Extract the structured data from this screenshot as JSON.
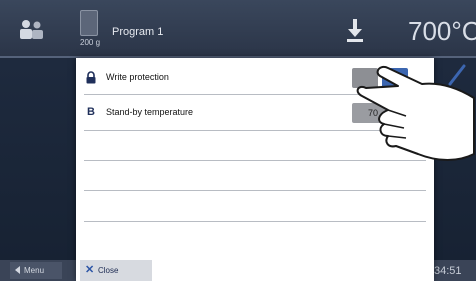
{
  "header": {
    "program_weight": "200 g",
    "program_title": "Program 1",
    "temperature": "700°C"
  },
  "dialog": {
    "rows": [
      {
        "icon": "lock-icon",
        "label": "Write protection",
        "control_a_label": "",
        "control_b_label": ""
      },
      {
        "icon": "B",
        "label": "Stand-by temperature",
        "value": "70"
      }
    ],
    "close_label": "Close"
  },
  "footer": {
    "menu_label": "Menu",
    "time": "34:51"
  },
  "colors": {
    "topbar": "#2f3a4f",
    "dialog_bg": "#ffffff",
    "accent_blue": "#3c66b0",
    "gray_button": "#8d8f94"
  }
}
